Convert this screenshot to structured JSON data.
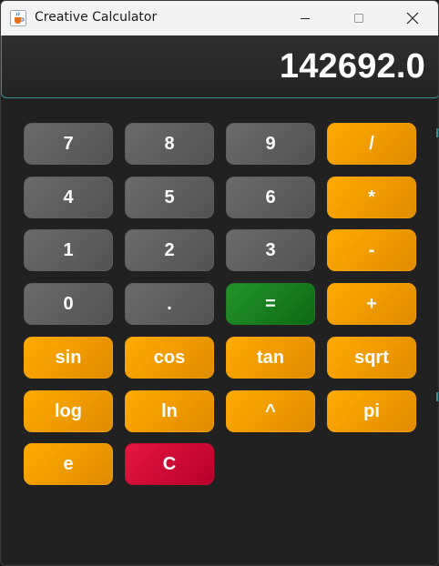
{
  "window": {
    "title": "Creative Calculator",
    "icons": {
      "app": "java-cup-icon",
      "minimize": "minimize-icon",
      "maximize": "maximize-icon",
      "close": "close-icon"
    }
  },
  "display": {
    "value": "142692.0"
  },
  "keys": [
    {
      "label": "7",
      "kind": "num"
    },
    {
      "label": "8",
      "kind": "num"
    },
    {
      "label": "9",
      "kind": "num"
    },
    {
      "label": "/",
      "kind": "op"
    },
    {
      "label": "4",
      "kind": "num"
    },
    {
      "label": "5",
      "kind": "num"
    },
    {
      "label": "6",
      "kind": "num"
    },
    {
      "label": "*",
      "kind": "op"
    },
    {
      "label": "1",
      "kind": "num"
    },
    {
      "label": "2",
      "kind": "num"
    },
    {
      "label": "3",
      "kind": "num"
    },
    {
      "label": "-",
      "kind": "op"
    },
    {
      "label": "0",
      "kind": "num"
    },
    {
      "label": ".",
      "kind": "num"
    },
    {
      "label": "=",
      "kind": "eq"
    },
    {
      "label": "+",
      "kind": "op"
    },
    {
      "label": "sin",
      "kind": "op"
    },
    {
      "label": "cos",
      "kind": "op"
    },
    {
      "label": "tan",
      "kind": "op"
    },
    {
      "label": "sqrt",
      "kind": "op"
    },
    {
      "label": "log",
      "kind": "op"
    },
    {
      "label": "ln",
      "kind": "op"
    },
    {
      "label": "^",
      "kind": "op"
    },
    {
      "label": "pi",
      "kind": "op"
    },
    {
      "label": "e",
      "kind": "op"
    },
    {
      "label": "C",
      "kind": "clr"
    }
  ],
  "colors": {
    "number_key": "#5e5e5e",
    "operator_key": "#ffa500",
    "equals_key": "#1a7f20",
    "clear_key": "#dc143c",
    "background": "#212121"
  }
}
